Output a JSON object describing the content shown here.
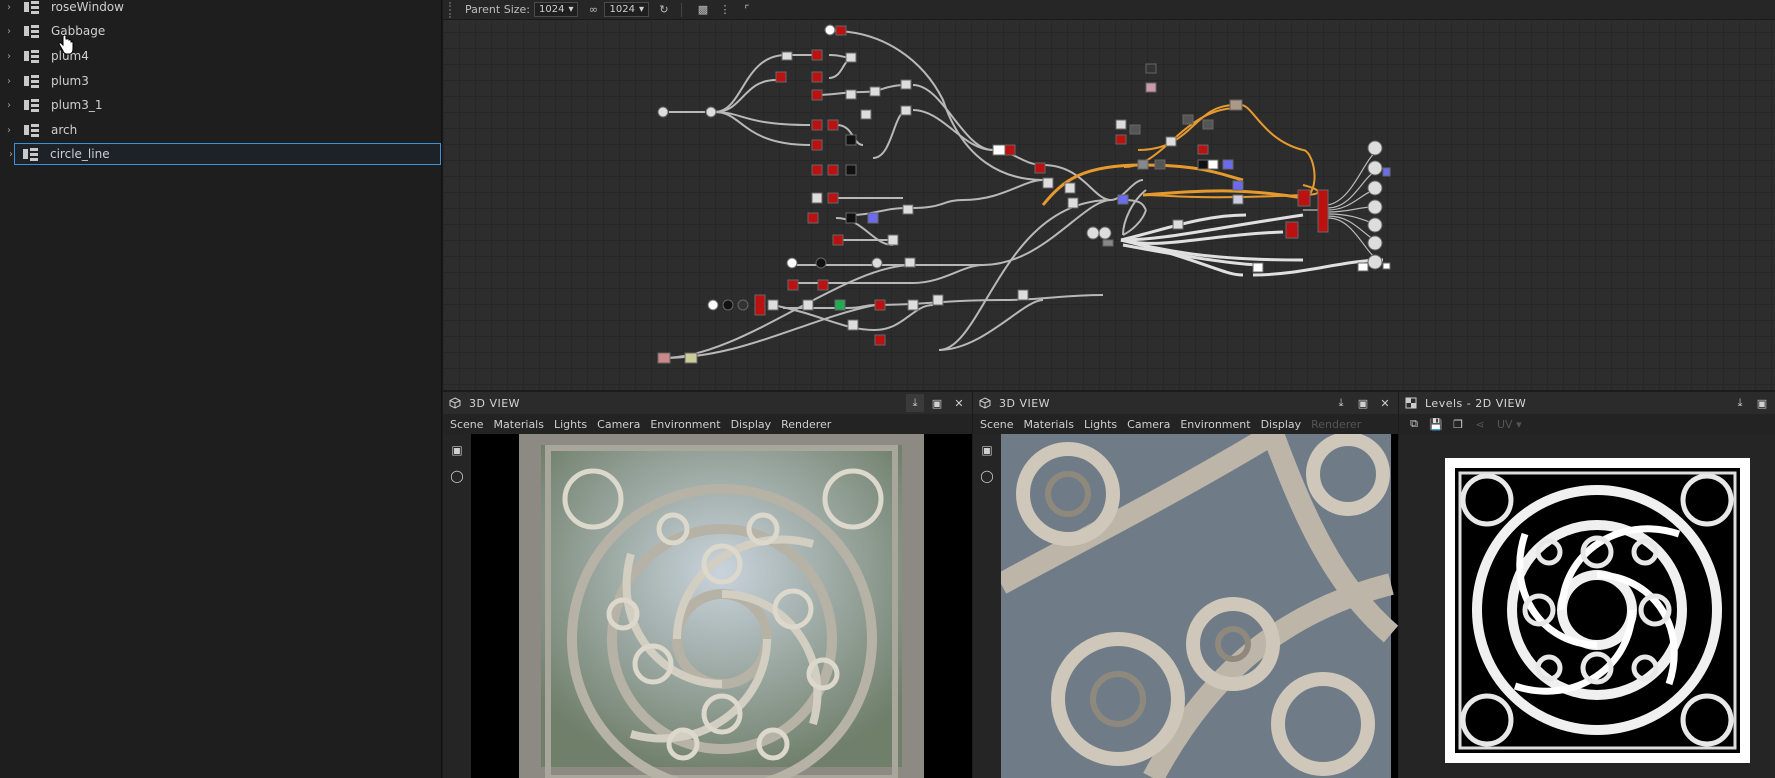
{
  "explorer": {
    "items": [
      {
        "label": "roseWindow",
        "selected": false
      },
      {
        "label": "Gabbage",
        "selected": false
      },
      {
        "label": "plum4",
        "selected": false
      },
      {
        "label": "plum3",
        "selected": false
      },
      {
        "label": "plum3_1",
        "selected": false
      },
      {
        "label": "arch",
        "selected": false
      },
      {
        "label": "circle_line",
        "selected": true
      }
    ]
  },
  "graph_toolbar": {
    "parent_size_label": "Parent Size:",
    "parent_size_value": "1024",
    "link_value": "1024"
  },
  "panels": {
    "view1": {
      "title": "3D VIEW",
      "menus": [
        "Scene",
        "Materials",
        "Lights",
        "Camera",
        "Environment",
        "Display",
        "Renderer"
      ]
    },
    "view2": {
      "title": "3D VIEW",
      "menus": [
        "Scene",
        "Materials",
        "Lights",
        "Camera",
        "Environment",
        "Display",
        "Renderer"
      ]
    },
    "view3": {
      "title": "Levels - 2D VIEW",
      "uv_label": "UV"
    }
  },
  "colors": {
    "selection_border": "#3f8fd9",
    "graph_bg": "#2d2d2d",
    "panel_bg": "#252525",
    "wire_light": "#cfcfcf",
    "wire_orange": "#e69a2e",
    "node_red": "#b3161f",
    "node_blue": "#6b6bf0"
  }
}
